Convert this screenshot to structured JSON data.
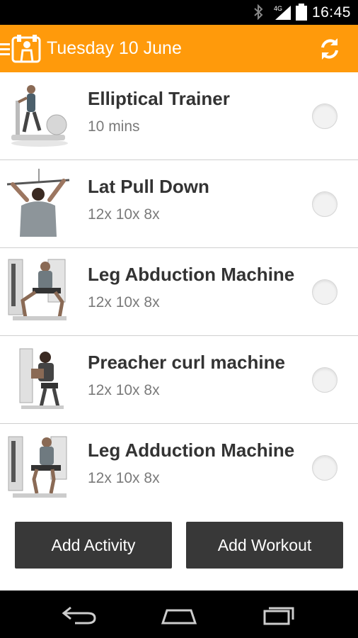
{
  "status_bar": {
    "time": "16:45",
    "network": "4G",
    "icons": [
      "bluetooth-icon",
      "signal-icon",
      "battery-icon"
    ]
  },
  "action_bar": {
    "title": "Tuesday 10 June",
    "accent_color": "#ff9a0b",
    "icons": [
      "menu-icon",
      "app-logo-icon",
      "refresh-icon"
    ]
  },
  "exercises": [
    {
      "name": "Elliptical Trainer",
      "detail": "10 mins",
      "checked": false
    },
    {
      "name": "Lat Pull Down",
      "detail": "12x 10x 8x",
      "checked": false
    },
    {
      "name": "Leg Abduction Machine",
      "detail": "12x 10x 8x",
      "checked": false
    },
    {
      "name": "Preacher curl machine",
      "detail": "12x 10x 8x",
      "checked": false
    },
    {
      "name": "Leg Adduction Machine",
      "detail": "12x 10x 8x",
      "checked": false
    }
  ],
  "buttons": {
    "add_activity": "Add Activity",
    "add_workout": "Add Workout"
  },
  "nav_bar": {
    "icons": [
      "back-icon",
      "home-icon",
      "recent-apps-icon"
    ]
  }
}
